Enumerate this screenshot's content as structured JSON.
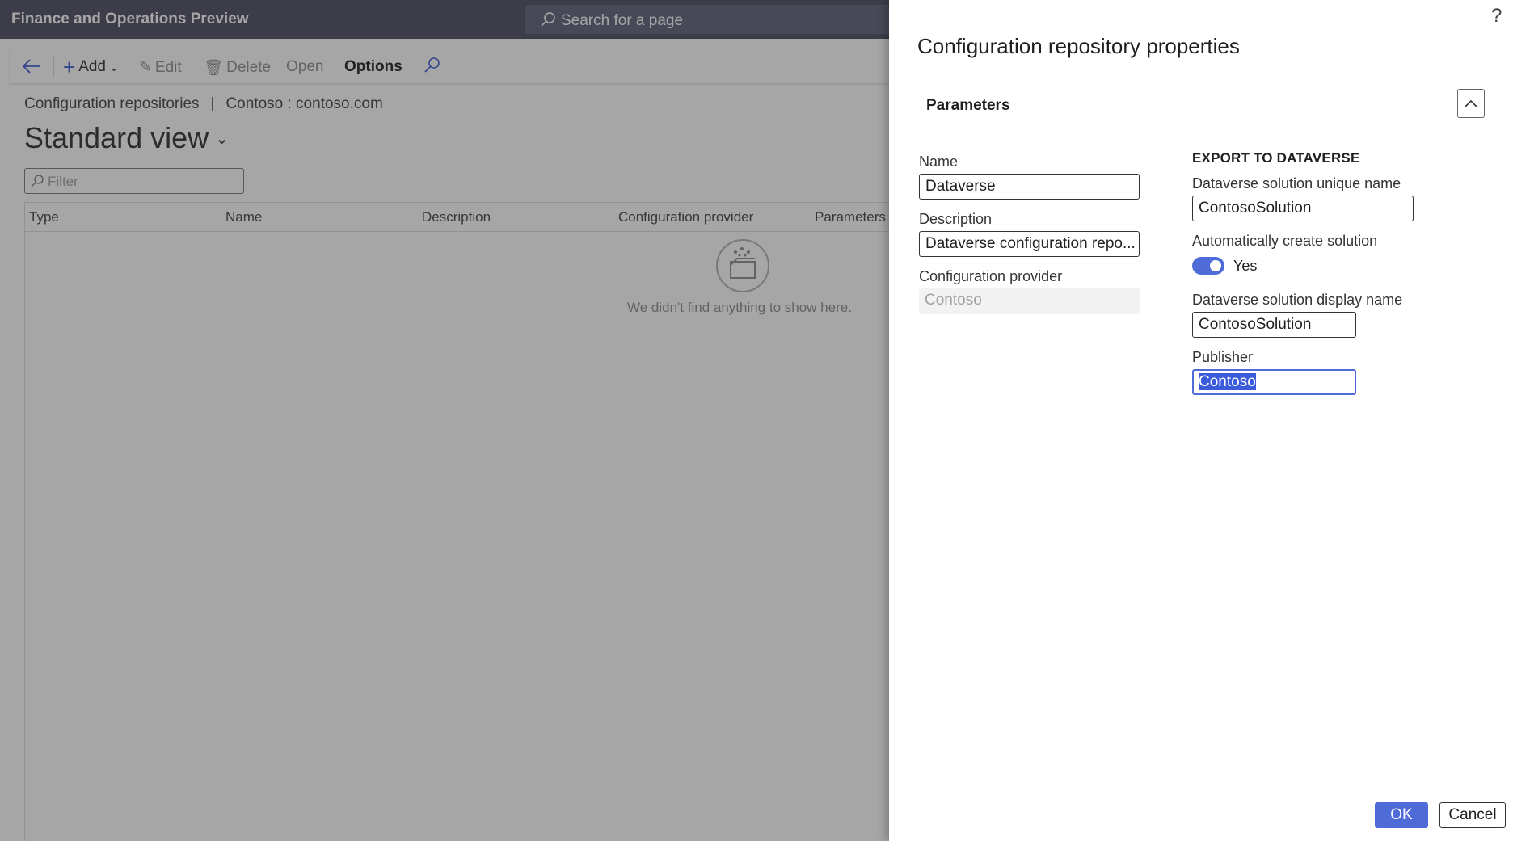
{
  "app": {
    "title": "Finance and Operations Preview",
    "search_placeholder": "Search for a page"
  },
  "toolbar": {
    "add_label": "Add",
    "edit_label": "Edit",
    "delete_label": "Delete",
    "open_label": "Open",
    "options_label": "Options"
  },
  "breadcrumb": {
    "first": "Configuration repositories",
    "separator": "|",
    "second": "Contoso : contoso.com"
  },
  "view": {
    "title": "Standard view"
  },
  "filter": {
    "placeholder": "Filter"
  },
  "grid": {
    "columns": [
      "Type",
      "Name",
      "Description",
      "Configuration provider",
      "Parameters"
    ],
    "empty_message": "We didn't find anything to show here."
  },
  "panel": {
    "title": "Configuration repository properties",
    "help": "?",
    "section_title": "Parameters",
    "name_label": "Name",
    "name_value": "Dataverse",
    "description_label": "Description",
    "description_value": "Dataverse configuration repo...",
    "provider_label": "Configuration provider",
    "provider_value": "Contoso",
    "export_heading": "EXPORT TO DATAVERSE",
    "unique_name_label": "Dataverse solution unique name",
    "unique_name_value": "ContosoSolution",
    "auto_create_label": "Automatically create solution",
    "auto_create_value": "Yes",
    "display_name_label": "Dataverse solution display name",
    "display_name_value": "ContosoSolution",
    "publisher_label": "Publisher",
    "publisher_value": "Contoso",
    "ok_label": "OK",
    "cancel_label": "Cancel"
  },
  "colors": {
    "accent": "#4f6bd8",
    "topbar": "#5c5f70"
  }
}
